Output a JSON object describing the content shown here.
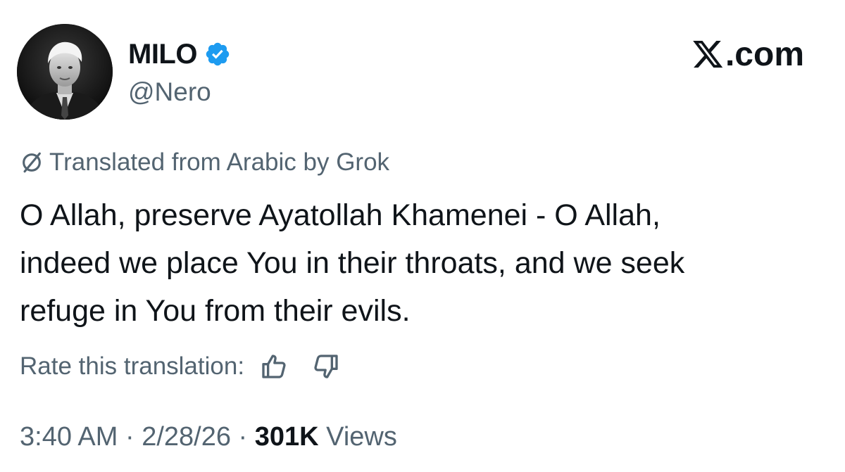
{
  "author": {
    "display_name": "MILO",
    "handle": "@Nero",
    "verified_icon": "verified-badge-icon",
    "avatar_icon": "profile-photo"
  },
  "site": {
    "logo_mark": "X",
    "logo_suffix": ".com"
  },
  "translation": {
    "icon": "globe-slash-icon",
    "note": "Translated from Arabic by Grok",
    "rate_label": "Rate this translation:",
    "rate_up_icon": "thumbs-up-icon",
    "rate_down_icon": "thumbs-down-icon"
  },
  "tweet": {
    "lines": [
      "O Allah, preserve Ayatollah Khamenei - O Allah,",
      "indeed we place You in their throats, and we seek",
      "refuge in You from their evils."
    ]
  },
  "meta": {
    "time": "3:40 AM",
    "separator": " · ",
    "date": "2/28/26",
    "views_count": "301K",
    "views_label": " Views"
  },
  "colors": {
    "text_primary": "#0f1419",
    "text_secondary": "#536471",
    "verified_blue": "#1d9bf0",
    "background": "#ffffff"
  }
}
